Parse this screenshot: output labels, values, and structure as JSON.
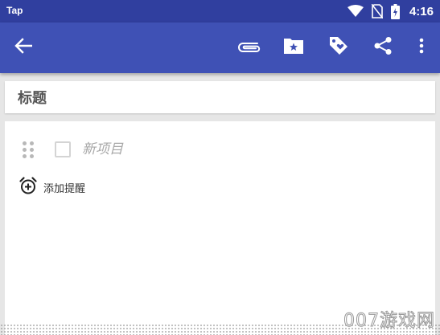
{
  "status_bar": {
    "app_name": "Tap",
    "time": "4:16",
    "icons": [
      "wifi-icon",
      "no-sim-icon",
      "battery-charging-icon"
    ]
  },
  "app_bar": {
    "actions": [
      "back-arrow-icon",
      "paperclip-icon",
      "folder-star-icon",
      "tag-icon",
      "share-icon",
      "more-vert-icon"
    ],
    "color": "#3f51b5"
  },
  "note": {
    "title_placeholder": "标题",
    "checklist": [
      {
        "placeholder": "新项目",
        "checked": false
      }
    ],
    "add_reminder_label": "添加提醒"
  },
  "watermark": "007游戏网",
  "colors": {
    "status_bar": "#303f9f",
    "app_bar": "#3f51b5",
    "background": "#e6e6e6",
    "card": "#ffffff"
  }
}
